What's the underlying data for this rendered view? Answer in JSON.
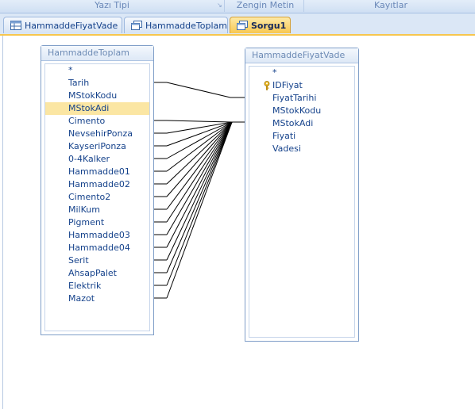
{
  "ribbon": {
    "groups": [
      "Yazı Tipi",
      "Zengin Metin",
      "Kayıtlar"
    ]
  },
  "tabs": [
    {
      "label": "HammaddeFiyatVade",
      "icon": "table-icon",
      "active": false
    },
    {
      "label": "HammaddeToplam",
      "icon": "query-icon",
      "active": false
    },
    {
      "label": "Sorgu1",
      "icon": "query-icon",
      "active": true
    }
  ],
  "tables": {
    "left": {
      "title": "HammaddeToplam",
      "fields": [
        "*",
        "Tarih",
        "MStokKodu",
        "MStokAdi",
        "Cimento",
        "NevsehirPonza",
        "KayseriPonza",
        "0-4Kalker",
        "Hammadde01",
        "Hammadde02",
        "Cimento2",
        "MilKum",
        "Pigment",
        "Hammadde03",
        "Hammadde04",
        "Serit",
        "AhsapPalet",
        "Elektrik",
        "Mazot"
      ],
      "selected": "MStokAdi"
    },
    "right": {
      "title": "HammaddeFiyatVade",
      "fields": [
        "*",
        "IDFiyat",
        "FiyatTarihi",
        "MStokKodu",
        "MStokAdi",
        "Fiyati",
        "Vadesi"
      ],
      "key_field": "IDFiyat"
    }
  },
  "colors": {
    "active_tab": "#f8c850",
    "selection": "#fbe6a3",
    "link_line": "#000000"
  }
}
